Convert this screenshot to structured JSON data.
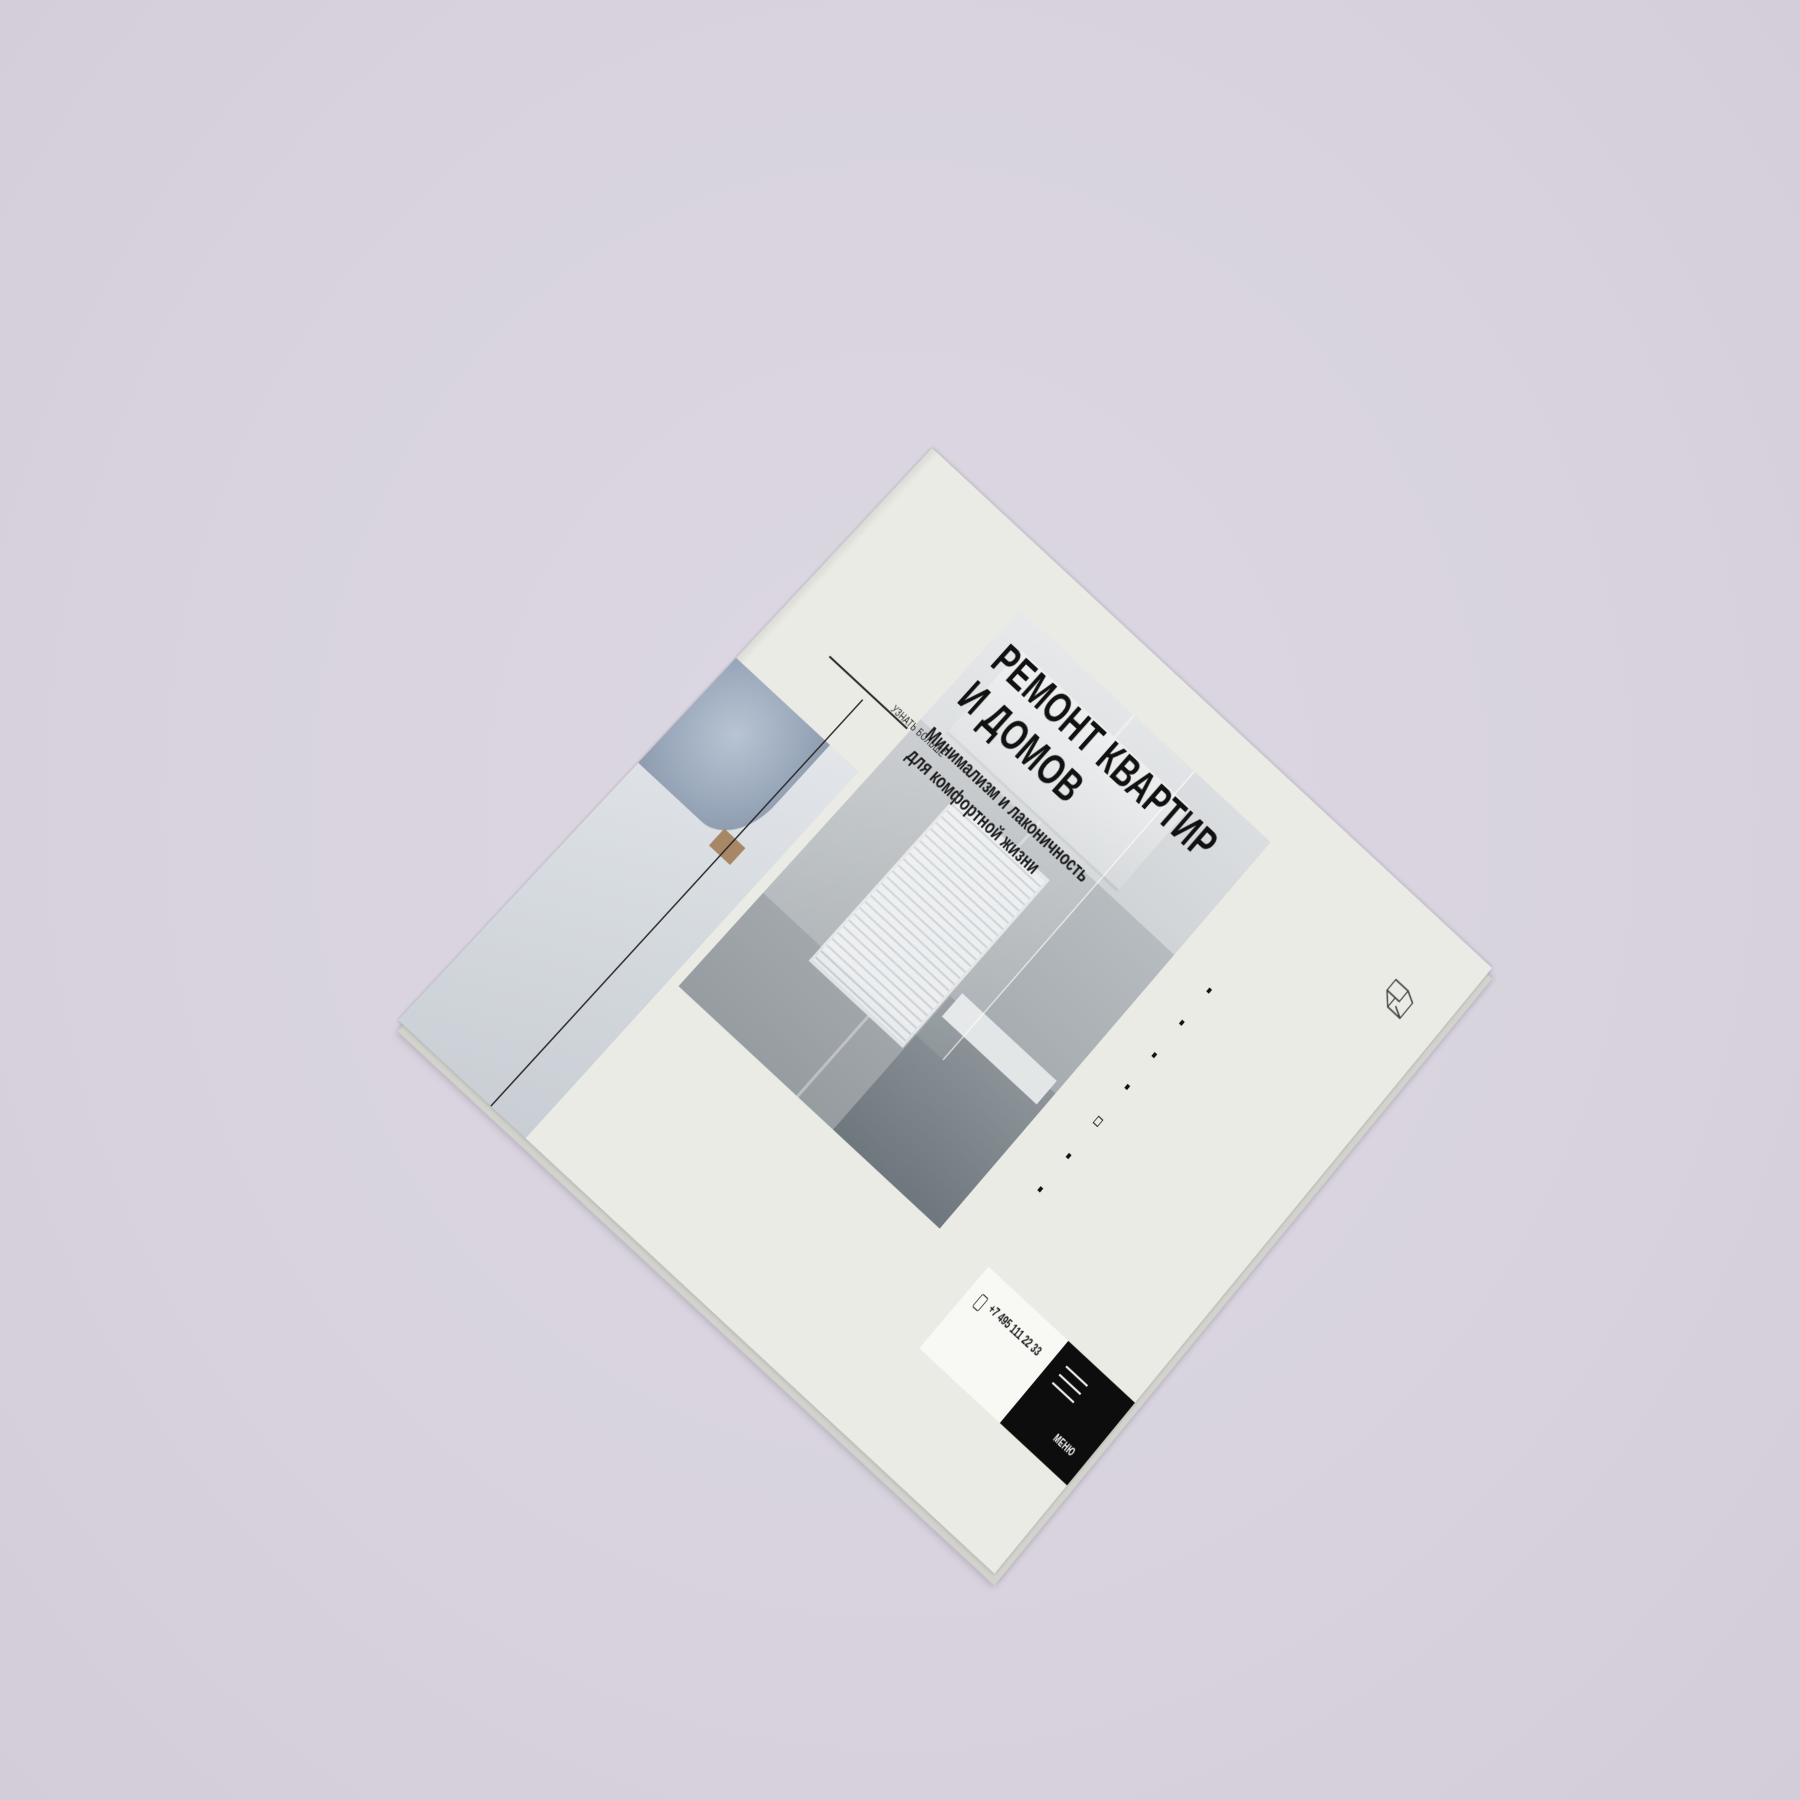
{
  "hero": {
    "title_line1": "РЕМОНТ КВАРТИР",
    "title_line2": "И ДОМОВ",
    "subtitle_line1": "Минимализм и лаконичность",
    "subtitle_line2": "для комфортной жизни"
  },
  "learn_more": {
    "label": "УЗНАТЬ БОЛЬШЕ"
  },
  "contact": {
    "phone": "+7 495 111 22 33"
  },
  "menu": {
    "label": "МЕНЮ"
  },
  "pagination": {
    "count": 7,
    "active_index": 4
  },
  "colors": {
    "background": "#dad5e0",
    "paper": "#ebebe6",
    "text": "#111111",
    "menu_bg": "#0d0d0d"
  }
}
